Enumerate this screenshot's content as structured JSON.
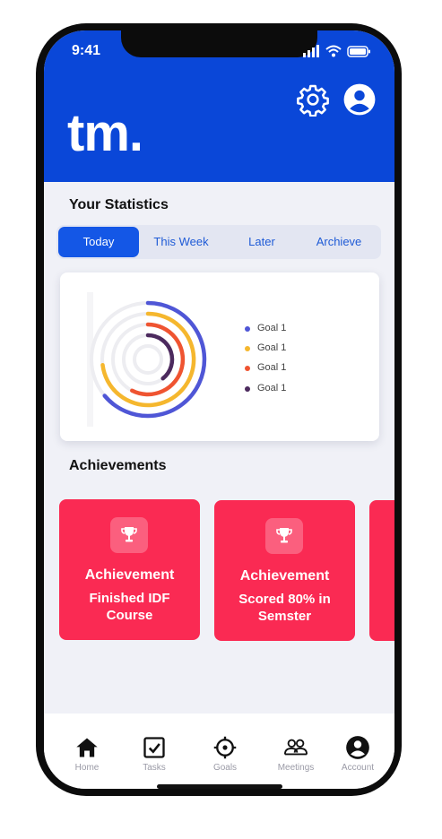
{
  "status_bar": {
    "time": "9:41"
  },
  "header": {
    "logo": "tm."
  },
  "statistics": {
    "title": "Your Statistics",
    "tabs": [
      {
        "label": "Today",
        "active": true
      },
      {
        "label": "This Week",
        "active": false
      },
      {
        "label": "Later",
        "active": false
      },
      {
        "label": "Archieve",
        "active": false
      }
    ],
    "legend": [
      {
        "label": "Goal 1",
        "color": "#4f56d6"
      },
      {
        "label": "Goal 1",
        "color": "#f5b72e"
      },
      {
        "label": "Goal 1",
        "color": "#ef5431"
      },
      {
        "label": "Goal 1",
        "color": "#4c2a5e"
      }
    ]
  },
  "achievements": {
    "title": "Achievements",
    "cards": [
      {
        "title": "Achievement",
        "description": "Finished IDF Course"
      },
      {
        "title": "Achievement",
        "description": "Scored 80% in Semster"
      }
    ]
  },
  "bottom_nav": {
    "items": [
      {
        "label": "Home",
        "icon": "home-icon"
      },
      {
        "label": "Tasks",
        "icon": "tasks-icon"
      },
      {
        "label": "Goals",
        "icon": "goals-icon"
      },
      {
        "label": "Meetings",
        "icon": "meetings-icon"
      },
      {
        "label": "Account",
        "icon": "account-icon"
      }
    ]
  },
  "colors": {
    "brand": "#0a47d8",
    "tab_active": "#1457e6",
    "achievement": "#fa2a53",
    "background": "#f0f1f7"
  }
}
